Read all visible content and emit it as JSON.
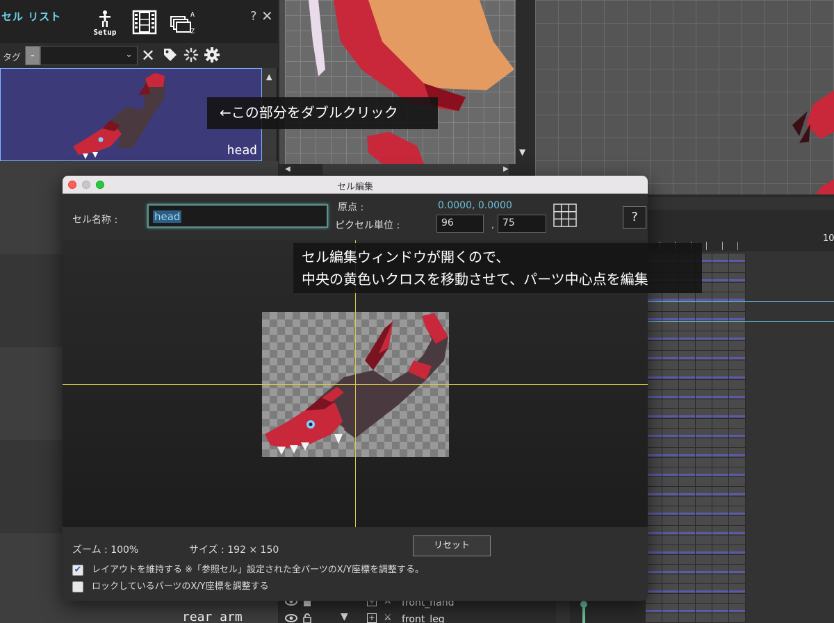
{
  "cell_list": {
    "title": "セル リスト",
    "setup_label": "Setup",
    "help_glyph": "?",
    "close_glyph": "✕",
    "tag_label": "タグ",
    "tag_minus": "-",
    "tag_chevron": "⌄",
    "scroll_up": "▲",
    "selected_item": "head",
    "bottom_label": "rear_arm"
  },
  "canvas": {
    "scroll_down": "▼",
    "scroll_left": "◀",
    "scroll_right": "▶"
  },
  "timeline": {
    "frame_number": "10",
    "layers": [
      {
        "name": "front_hand",
        "expand": ""
      },
      {
        "name": "front_leg",
        "expand": "▼"
      }
    ]
  },
  "callouts": {
    "double_click": "←この部分をダブルクリック",
    "edit_window_line1": "セル編集ウィンドウが開くので、",
    "edit_window_line2": "中央の黄色いクロスを移動させて、パーツ中心点を編集"
  },
  "dialog": {
    "title": "セル編集",
    "cell_name_label": "セル名称 :",
    "cell_name_value": "head",
    "origin_label": "原点 :",
    "origin_value": "0.0000, 0.0000",
    "pixel_unit_label": "ピクセル単位 :",
    "pixel_x": "96",
    "pixel_comma": ",",
    "pixel_y": "75",
    "help": "?",
    "zoom_label": "ズーム : 100%",
    "size_label": "サイズ : 192 × 150",
    "reset_label": "リセット",
    "keep_layout": {
      "checked": true,
      "label": "レイアウトを維持する ※「参照セル」設定された全パーツのX/Y座標を調整する。"
    },
    "adjust_locked": {
      "checked": false,
      "label": "ロックしているパーツのX/Y座標を調整する"
    }
  },
  "colors": {
    "accent": "#6fd3ea",
    "crosshair": "#d8c84a",
    "selection": "#3d3a7a",
    "dragon_red": "#c8283a",
    "dragon_dark": "#4a3a40"
  },
  "icons": [
    "setup-figure-icon",
    "filmstrip-icon",
    "sort-az-icon",
    "clear-x-icon",
    "tag-icon",
    "spinner-icon",
    "gear-icon",
    "grid-icon",
    "eye-icon",
    "lock-icon"
  ]
}
